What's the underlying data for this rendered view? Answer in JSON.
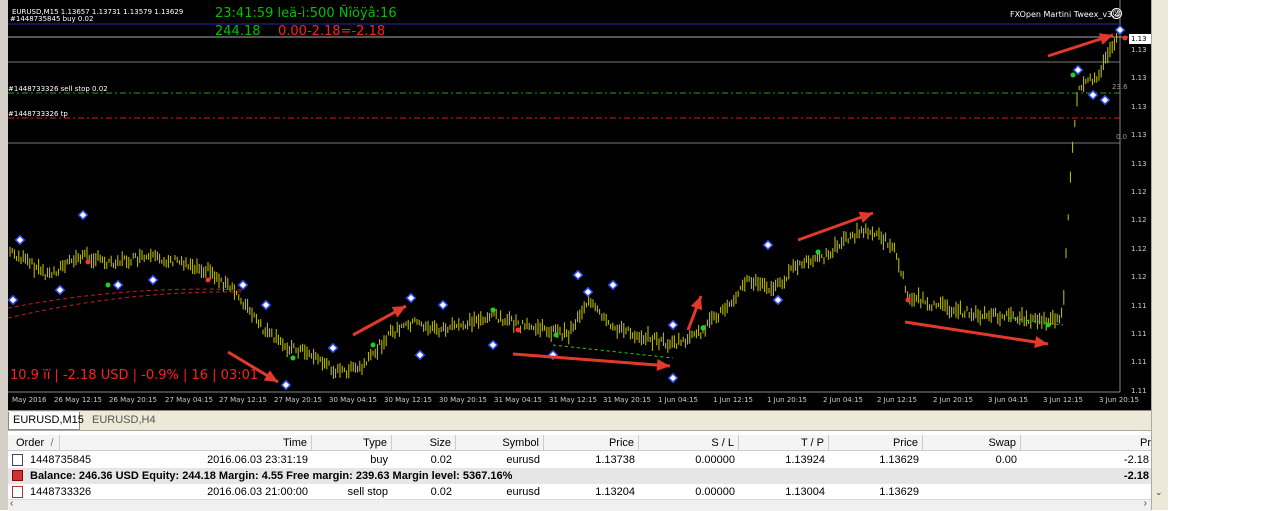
{
  "chart": {
    "symbol_header": "EURUSD,M15  1.13657 1.13731 1.13579 1.13629",
    "order_line_label": "#1448735845 buy 0.02",
    "timer_line": "23:41:59 leä-ì:500 Ñîöÿâ:16",
    "equity_line_value": "244.18",
    "equity_line_pl": "0.00-2.18=-2.18",
    "ea_name": "FXOpen Martini Tweex_v3.4",
    "sellstop_label": "#1448733326 sell stop 0.02",
    "tp_label": "#1448733326 tp",
    "bottom_stats": "10.9 ïï | -2.18 USD | -0.9% | 16 | 03:01",
    "fib_labels": [
      "23.6",
      "0.0"
    ],
    "price_axis": [
      "1.13",
      "1.13",
      "1.13",
      "1.13",
      "1.13",
      "1.12",
      "1.12",
      "1.12",
      "1.12",
      "1.11",
      "1.11",
      "1.11",
      "1.11",
      "1.10"
    ],
    "current_price_label": "1.13",
    "time_axis": [
      "May 2016",
      "26 May 12:15",
      "26 May 20:15",
      "27 May 04:15",
      "27 May 12:15",
      "27 May 20:15",
      "30 May 04:15",
      "30 May 12:15",
      "30 May 20:15",
      "31 May 04:15",
      "31 May 12:15",
      "31 May 20:15",
      "1 Jun 04:15",
      "1 Jun 12:15",
      "1 Jun 20:15",
      "2 Jun 04:15",
      "2 Jun 12:15",
      "2 Jun 20:15",
      "3 Jun 04:15",
      "3 Jun 12:15",
      "3 Jun 20:15"
    ],
    "colors": {
      "bg": "#000000",
      "candles": "#c8c800",
      "text_green": "#00c000",
      "text_red": "#ff2020",
      "arrow": "#e23a2a",
      "buy_marker": "#3050ff"
    }
  },
  "tabs": [
    "EURUSD,M15",
    "EURUSD,H4"
  ],
  "terminal": {
    "headers": [
      "Order",
      "/",
      "Time",
      "Type",
      "Size",
      "Symbol",
      "Price",
      "S / L",
      "T / P",
      "Price",
      "Swap",
      "Pr"
    ],
    "rows": [
      {
        "order": "1448735845",
        "time": "2016.06.03 23:31:19",
        "type": "buy",
        "size": "0.02",
        "symbol": "eurusd",
        "price": "1.13738",
        "sl": "0.00000",
        "tp": "1.13924",
        "cur_price": "1.13629",
        "swap": "0.00",
        "profit": "-2.18"
      },
      {
        "order": "1448733326",
        "time": "2016.06.03 21:00:00",
        "type": "sell stop",
        "size": "0.02",
        "symbol": "eurusd",
        "price": "1.13204",
        "sl": "0.00000",
        "tp": "1.13004",
        "cur_price": "1.13629",
        "swap": "",
        "profit": ""
      }
    ],
    "balance_text": "Balance: 246.36 USD  Equity: 244.18  Margin: 4.55  Free margin: 239.63  Margin level: 5367.16%",
    "balance_profit": "-2.18"
  },
  "icons": [
    "document-icon",
    "balance-icon",
    "scroll-left-icon",
    "scroll-right-icon",
    "scroll-down-icon",
    "gear-icon"
  ]
}
